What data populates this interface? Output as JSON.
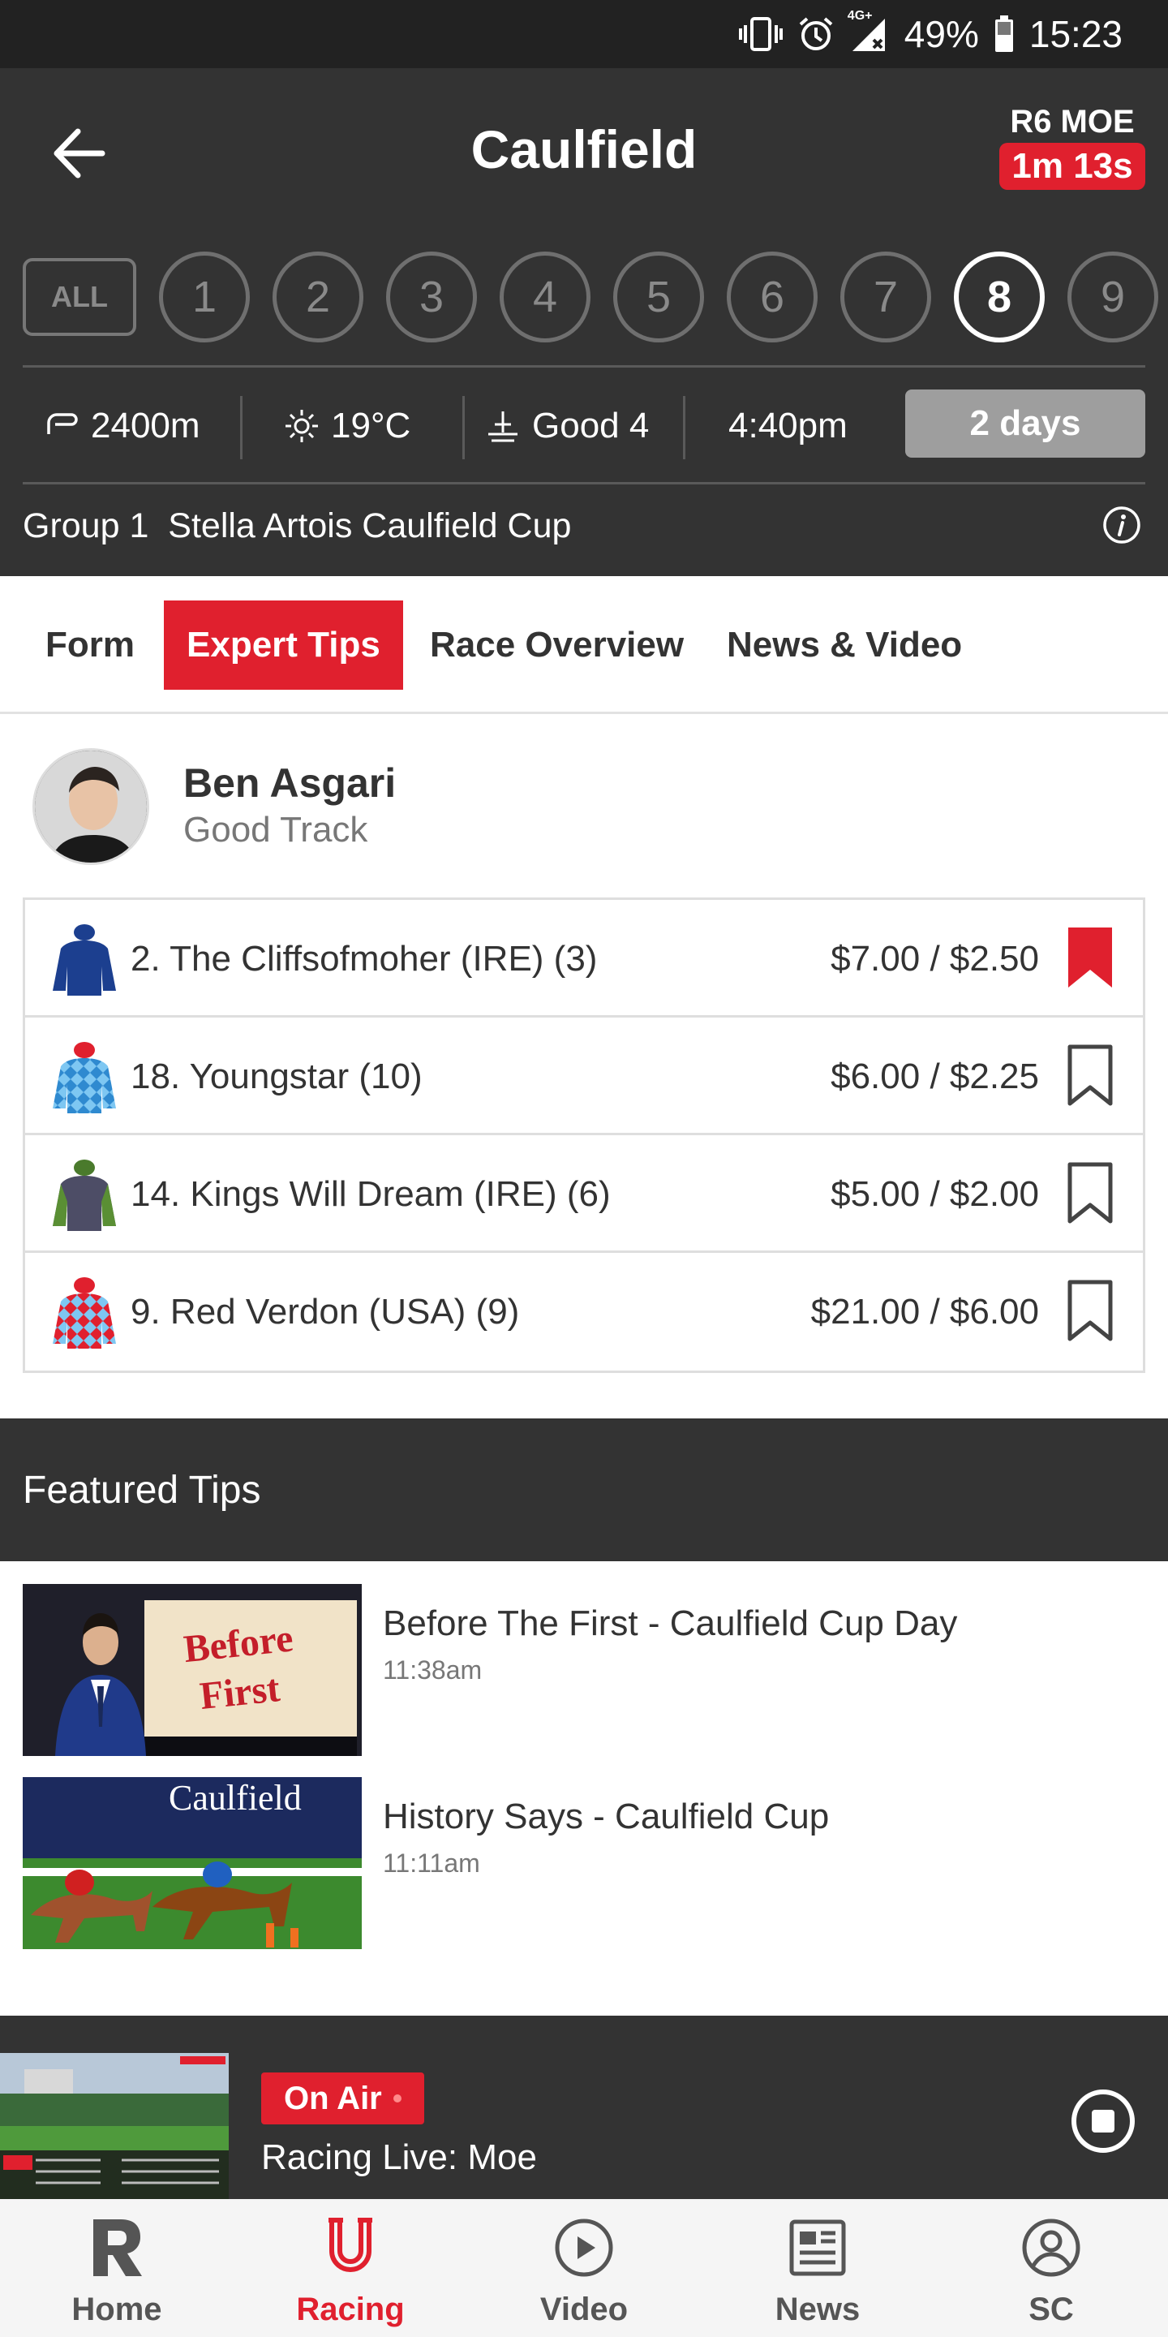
{
  "status_bar": {
    "network": "4G+",
    "battery": "49%",
    "time": "15:23"
  },
  "header": {
    "title": "Caulfield",
    "next_race_label": "R6 MOE",
    "countdown": "1m 13s"
  },
  "race_selector": {
    "all_label": "ALL",
    "races": [
      "1",
      "2",
      "3",
      "4",
      "5",
      "6",
      "7",
      "8",
      "9"
    ],
    "selected": "8"
  },
  "race_info": {
    "distance": "2400m",
    "temperature": "19°C",
    "track": "Good 4",
    "start_time": "4:40pm",
    "countdown_button": "2 days"
  },
  "race_name": {
    "group": "Group 1",
    "name": "Stella Artois Caulfield Cup"
  },
  "tabs": [
    "Form",
    "Expert Tips",
    "Race Overview",
    "News & Video"
  ],
  "active_tab": "Expert Tips",
  "expert": {
    "name": "Ben Asgari",
    "subtitle": "Good Track"
  },
  "tips": [
    {
      "runner": "2. The Cliffsofmoher (IRE) (3)",
      "odds": "$7.00 / $2.50",
      "bookmarked": true,
      "silk": "blue"
    },
    {
      "runner": "18. Youngstar (10)",
      "odds": "$6.00 / $2.25",
      "bookmarked": false,
      "silk": "lightblue-diamonds"
    },
    {
      "runner": "14. Kings Will Dream (IRE) (6)",
      "odds": "$5.00 / $2.00",
      "bookmarked": false,
      "silk": "green-grey"
    },
    {
      "runner": "9. Red Verdon (USA) (9)",
      "odds": "$21.00 / $6.00",
      "bookmarked": false,
      "silk": "red-blue-diamonds"
    }
  ],
  "featured": {
    "heading": "Featured Tips",
    "thumb_text": [
      "Before",
      "First"
    ],
    "thumb2_text": "Caulfield",
    "videos": [
      {
        "title": "Before The First - Caulfield Cup Day",
        "time": "11:38am"
      },
      {
        "title": "History Says - Caulfield Cup",
        "time": "11:11am"
      }
    ]
  },
  "on_air": {
    "badge": "On Air",
    "title": "Racing Live: Moe"
  },
  "bottom_nav": [
    {
      "label": "Home",
      "icon": "racing-r-logo-icon"
    },
    {
      "label": "Racing",
      "icon": "horseshoe-icon"
    },
    {
      "label": "Video",
      "icon": "play-circle-icon"
    },
    {
      "label": "News",
      "icon": "newspaper-icon"
    },
    {
      "label": "SC",
      "icon": "user-circle-icon"
    }
  ],
  "active_nav": "Racing",
  "colors": {
    "accent": "#e0202e",
    "header_bg": "#333333",
    "status_bg": "#222222"
  }
}
